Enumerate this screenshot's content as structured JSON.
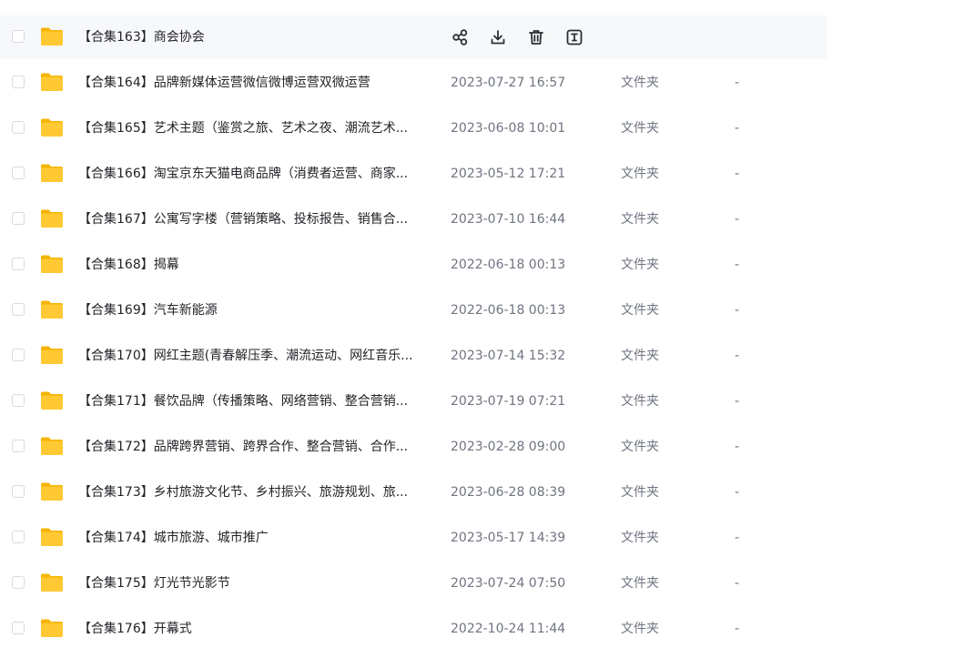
{
  "rows": [
    {
      "name": "【合集163】商会协会",
      "date": "",
      "type": "",
      "size": "",
      "hovered": true
    },
    {
      "name": "【合集164】品牌新媒体运营微信微博运营双微运营",
      "date": "2023-07-27 16:57",
      "type": "文件夹",
      "size": "-"
    },
    {
      "name": "【合集165】艺术主题（鉴赏之旅、艺术之夜、潮流艺术...",
      "date": "2023-06-08 10:01",
      "type": "文件夹",
      "size": "-"
    },
    {
      "name": "【合集166】淘宝京东天猫电商品牌（消费者运营、商家...",
      "date": "2023-05-12 17:21",
      "type": "文件夹",
      "size": "-"
    },
    {
      "name": "【合集167】公寓写字楼（营销策略、投标报告、销售合...",
      "date": "2023-07-10 16:44",
      "type": "文件夹",
      "size": "-"
    },
    {
      "name": "【合集168】揭幕",
      "date": "2022-06-18 00:13",
      "type": "文件夹",
      "size": "-"
    },
    {
      "name": "【合集169】汽车新能源",
      "date": "2022-06-18 00:13",
      "type": "文件夹",
      "size": "-"
    },
    {
      "name": "【合集170】网红主题(青春解压季、潮流运动、网红音乐...",
      "date": "2023-07-14 15:32",
      "type": "文件夹",
      "size": "-"
    },
    {
      "name": "【合集171】餐饮品牌（传播策略、网络营销、整合营销...",
      "date": "2023-07-19 07:21",
      "type": "文件夹",
      "size": "-"
    },
    {
      "name": "【合集172】品牌跨界营销、跨界合作、整合营销、合作...",
      "date": "2023-02-28 09:00",
      "type": "文件夹",
      "size": "-"
    },
    {
      "name": "【合集173】乡村旅游文化节、乡村振兴、旅游规划、旅...",
      "date": "2023-06-28 08:39",
      "type": "文件夹",
      "size": "-"
    },
    {
      "name": "【合集174】城市旅游、城市推广",
      "date": "2023-05-17 14:39",
      "type": "文件夹",
      "size": "-"
    },
    {
      "name": "【合集175】灯光节光影节",
      "date": "2023-07-24 07:50",
      "type": "文件夹",
      "size": "-"
    },
    {
      "name": "【合集176】开幕式",
      "date": "2022-10-24 11:44",
      "type": "文件夹",
      "size": "-"
    }
  ],
  "hover_actions": [
    {
      "icon": "share-icon"
    },
    {
      "icon": "download-icon"
    },
    {
      "icon": "delete-icon"
    },
    {
      "icon": "rename-icon"
    }
  ],
  "colors": {
    "folder": "#ffc933",
    "folder_back": "#f5b400",
    "hover_bg": "#f7f8fa",
    "text_primary": "#222428",
    "text_secondary": "#6f7480",
    "icon": "#2b2f36"
  }
}
